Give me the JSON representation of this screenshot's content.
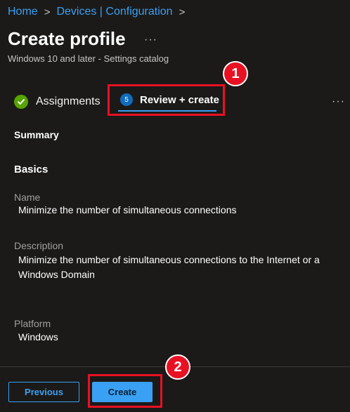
{
  "breadcrumb": {
    "items": [
      "Home",
      "Devices | Configuration"
    ],
    "separator": ">"
  },
  "header": {
    "title": "Create profile",
    "more": "···",
    "subtitle": "Windows 10 and later - Settings catalog"
  },
  "tabs": {
    "assignments": "Assignments",
    "review": "Review + create",
    "review_step": "5",
    "more": "···"
  },
  "annotations": {
    "badge1": "1",
    "badge2": "2",
    "color": "#e81123"
  },
  "summary": {
    "heading": "Summary",
    "basics_heading": "Basics",
    "fields": [
      {
        "label": "Name",
        "value": "Minimize the number of simultaneous connections"
      },
      {
        "label": "Description",
        "value": "Minimize the number of simultaneous connections to the Internet or a Windows Domain"
      },
      {
        "label": "Platform",
        "value": "Windows"
      }
    ]
  },
  "footer": {
    "previous_label": "Previous",
    "create_label": "Create"
  },
  "colors": {
    "background": "#1b1a19",
    "accent": "#3aa0f3",
    "success": "#57a300"
  }
}
